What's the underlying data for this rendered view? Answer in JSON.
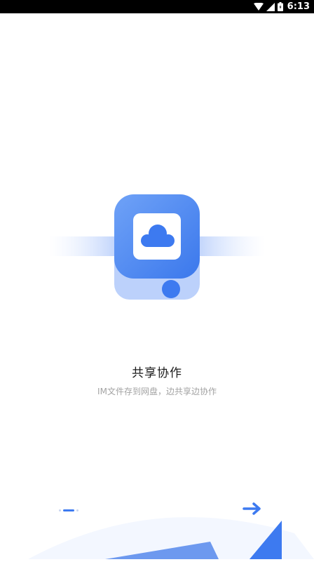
{
  "status_bar": {
    "time": "6:13",
    "icons": [
      "wifi-icon",
      "cellular-signal-icon",
      "battery-icon"
    ]
  },
  "onboarding": {
    "illustration": "cloud-drive-icon",
    "title": "共享协作",
    "subtitle": "IM文件存到网盘，边共享边协作",
    "page_indicator": {
      "current": 1,
      "total": 3
    },
    "next_icon": "arrow-right-icon"
  },
  "colors": {
    "accent": "#3d7af0",
    "light_accent": "#d8e5ff",
    "title_text": "#1b1b1b",
    "subtitle_text": "#a3a3a3",
    "status_bar": "#000000"
  }
}
